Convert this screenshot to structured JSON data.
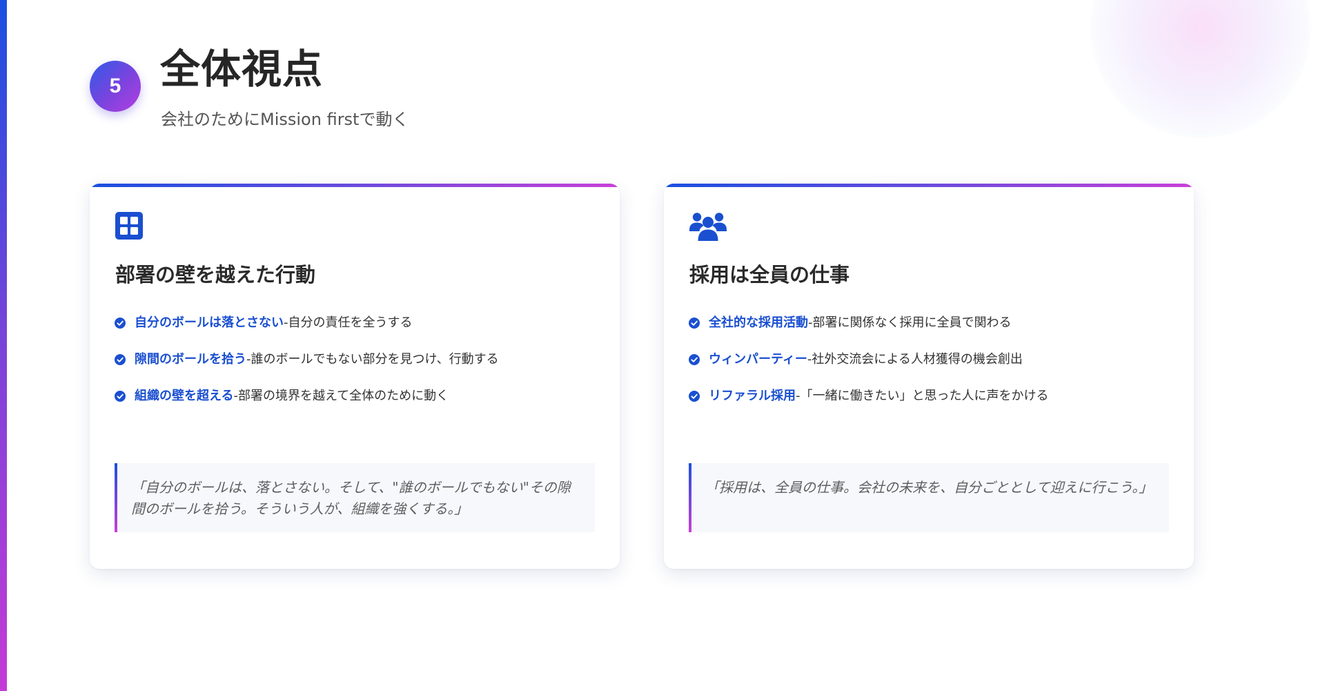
{
  "header": {
    "step_number": "5",
    "title": "全体視点",
    "subtitle": "会社のためにMission firstで動く"
  },
  "colors": {
    "accent_blue": "#1a4fe0",
    "accent_purple": "#7d43de",
    "accent_pink": "#c940d8"
  },
  "cards": [
    {
      "icon": "grid-icon",
      "title": "部署の壁を越えた行動",
      "points": [
        {
          "key": "自分のボールは落とさない",
          "sep": " - ",
          "desc": "自分の責任を全うする"
        },
        {
          "key": "隙間のボールを拾う",
          "sep": " - ",
          "desc": "誰のボールでもない部分を見つけ、行動する"
        },
        {
          "key": "組織の壁を超える",
          "sep": " - ",
          "desc": "部署の境界を越えて全体のために動く"
        }
      ],
      "quote": "「自分のボールは、落とさない。そして、\"誰のボールでもない\"その隙間のボールを拾う。そういう人が、組織を強くする。」"
    },
    {
      "icon": "users-icon",
      "title": "採用は全員の仕事",
      "points": [
        {
          "key": "全社的な採用活動",
          "sep": " - ",
          "desc": "部署に関係なく採用に全員で関わる"
        },
        {
          "key": "ウィンパーティー",
          "sep": " - ",
          "desc": "社外交流会による人材獲得の機会創出"
        },
        {
          "key": "リファラル採用",
          "sep": " - ",
          "desc": "「一緒に働きたい」と思った人に声をかける"
        }
      ],
      "quote": "「採用は、全員の仕事。会社の未来を、自分ごととして迎えに行こう。」"
    }
  ]
}
